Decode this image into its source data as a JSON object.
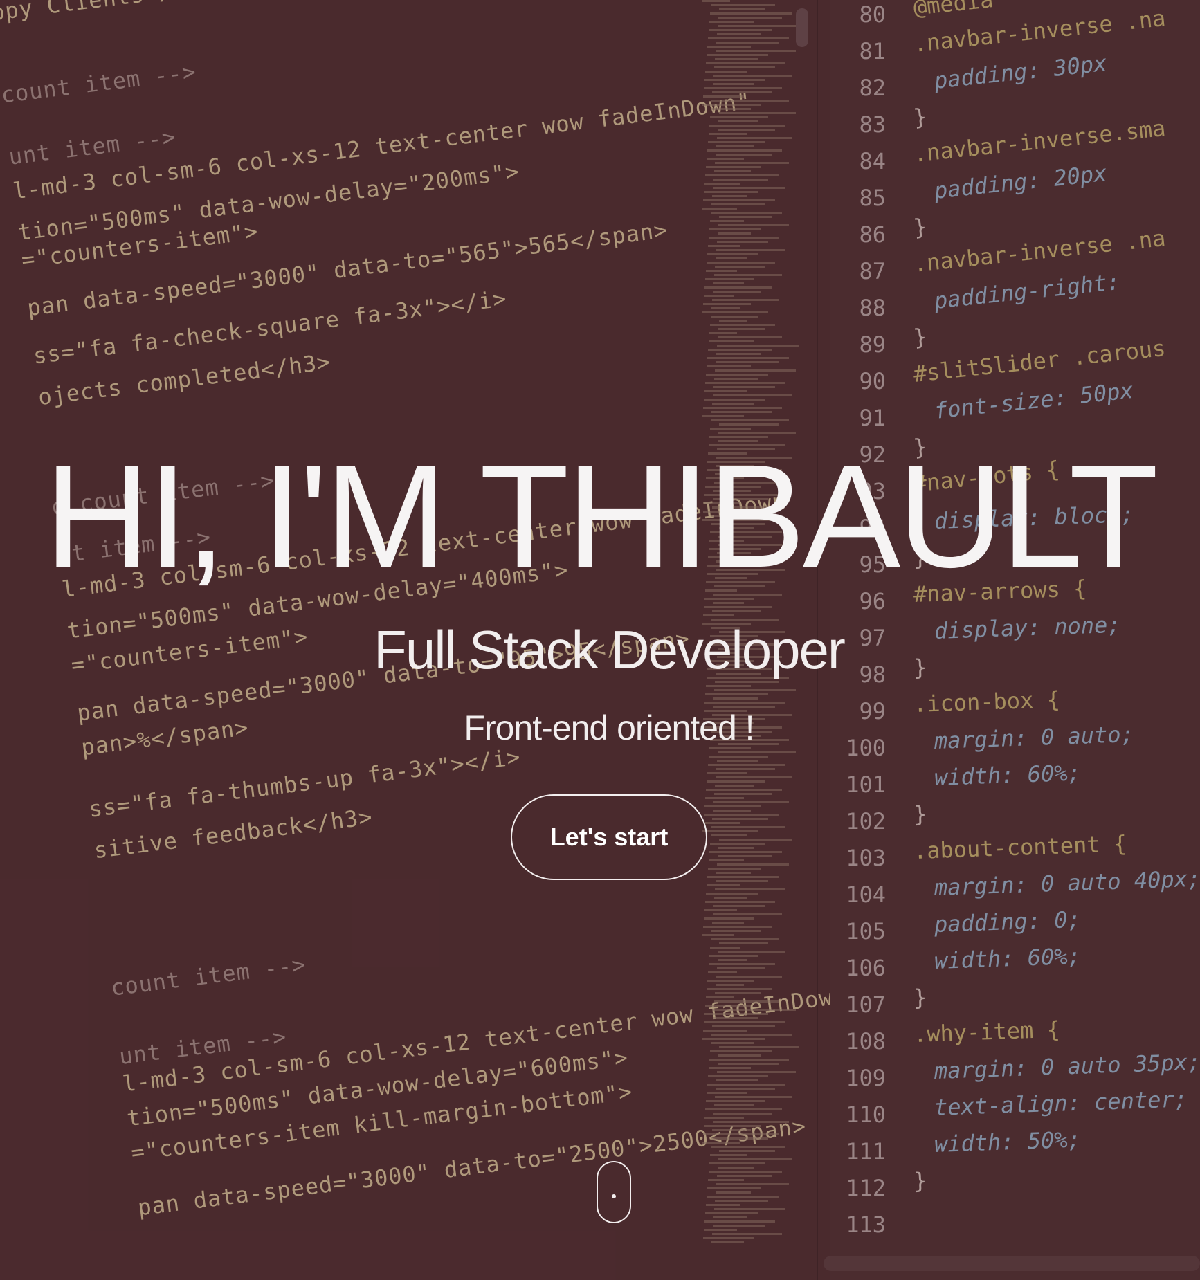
{
  "hero": {
    "title": "HI, I'M THIBAULT",
    "subtitle": "Full Stack Developer",
    "tagline": "Front-end oriented !",
    "cta_label": "Let's start"
  },
  "background": {
    "left_code": [
      {
        "text": "ppy Clients</",
        "kind": "code"
      },
      {
        "text": "count item -->",
        "kind": "comment"
      },
      {
        "text": "unt item -->",
        "kind": "comment"
      },
      {
        "text": "l-md-3 col-sm-6 col-xs-12 text-center wow fadeInDown\"",
        "kind": "code"
      },
      {
        "text": "tion=\"500ms\" data-wow-delay=\"200ms\">",
        "kind": "code"
      },
      {
        "text": "=\"counters-item\">",
        "kind": "code"
      },
      {
        "text": "pan data-speed=\"3000\" data-to=\"565\">565</span>",
        "kind": "code"
      },
      {
        "text": "ss=\"fa fa-check-square fa-3x\"></i>",
        "kind": "code"
      },
      {
        "text": "ojects completed</h3>",
        "kind": "code"
      },
      {
        "text": "d count item -->",
        "kind": "comment"
      },
      {
        "text": "nt item -->",
        "kind": "comment"
      },
      {
        "text": "l-md-3 col-sm-6 col-xs-12 text-center wow fadeInDown",
        "kind": "code"
      },
      {
        "text": "tion=\"500ms\" data-wow-delay=\"400ms\">",
        "kind": "code"
      },
      {
        "text": "=\"counters-item\">",
        "kind": "code"
      },
      {
        "text": "pan data-speed=\"3000\" data-to=\"95\">95</span>",
        "kind": "code"
      },
      {
        "text": "pan>%</span>",
        "kind": "code"
      },
      {
        "text": "ss=\"fa fa-thumbs-up fa-3x\"></i>",
        "kind": "code"
      },
      {
        "text": "sitive feedback</h3>",
        "kind": "code"
      },
      {
        "text": "count item -->",
        "kind": "comment"
      },
      {
        "text": "unt item -->",
        "kind": "comment"
      },
      {
        "text": "l-md-3 col-sm-6 col-xs-12 text-center wow fadeInDown\"",
        "kind": "code"
      },
      {
        "text": "tion=\"500ms\" data-wow-delay=\"600ms\">",
        "kind": "code"
      },
      {
        "text": "=\"counters-item kill-margin-bottom\">",
        "kind": "code"
      },
      {
        "text": "pan data-speed=\"3000\" data-to=\"2500\">2500</span>",
        "kind": "code"
      }
    ],
    "line_numbers": [
      "80",
      "81",
      "82",
      "83",
      "84",
      "85",
      "86",
      "87",
      "88",
      "89",
      "90",
      "91",
      "92",
      "93",
      "94",
      "95",
      "96",
      "97",
      "98",
      "99",
      "100",
      "101",
      "102",
      "103",
      "104",
      "105",
      "106",
      "107",
      "108",
      "109",
      "110",
      "111",
      "112",
      "113"
    ],
    "css_code": [
      "@media",
      ".navbar-inverse .na",
      "padding: 30px",
      "}",
      ".navbar-inverse.sma",
      "padding: 20px",
      "}",
      ".navbar-inverse .na",
      "padding-right:",
      "}",
      "#slitSlider .carous",
      "font-size: 50px",
      "}",
      "#nav-dots {",
      "display: block;",
      "}",
      "#nav-arrows {",
      "display: none;",
      "}",
      ".icon-box {",
      "margin: 0 auto;",
      "width: 60%;",
      "}",
      ".about-content {",
      "margin: 0 auto 40px;",
      "padding: 0;",
      "width: 60%;",
      "}",
      ".why-item {",
      "margin: 0 auto 35px;",
      "text-align: center;",
      "width: 50%;",
      "}"
    ]
  },
  "colors": {
    "background": "#4a2b2e",
    "text": "#f6f4f4",
    "code_string": "#e7d7a8",
    "code_tag": "#e0557a",
    "css_property": "#9ec7e3",
    "css_number": "#c07fe0"
  },
  "icons": {
    "scroll_indicator": "mouse-scroll-icon"
  }
}
